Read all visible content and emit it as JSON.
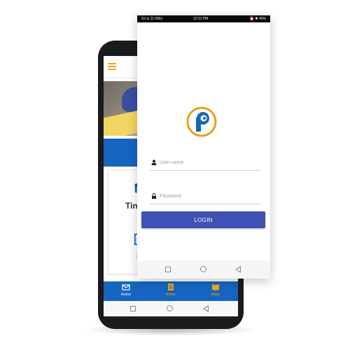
{
  "login_screen": {
    "status_bar": {
      "left": "Sıl ≋ 11 KB/s",
      "time": "12:31 PM",
      "right": "⏰ ✱ 45%"
    },
    "username": {
      "placeholder": "User name",
      "value": ""
    },
    "password": {
      "placeholder": "Password",
      "value": ""
    },
    "login_label": "LOGIN",
    "accent": "#3f51b5",
    "logo_color": "#f39c12"
  },
  "home_screen": {
    "card_items": [
      {
        "label": "Time",
        "icon": "calendar-icon"
      },
      {
        "label": "F",
        "icon": "document-icon"
      }
    ],
    "bottom_nav": [
      {
        "label": "Home",
        "icon": "home-icon"
      },
      {
        "label": "Inbox",
        "icon": "inbox-icon"
      },
      {
        "label": "Diary",
        "icon": "book-icon"
      }
    ],
    "primary_color": "#1565c0",
    "menu_icon_color": "#f4a31b"
  }
}
